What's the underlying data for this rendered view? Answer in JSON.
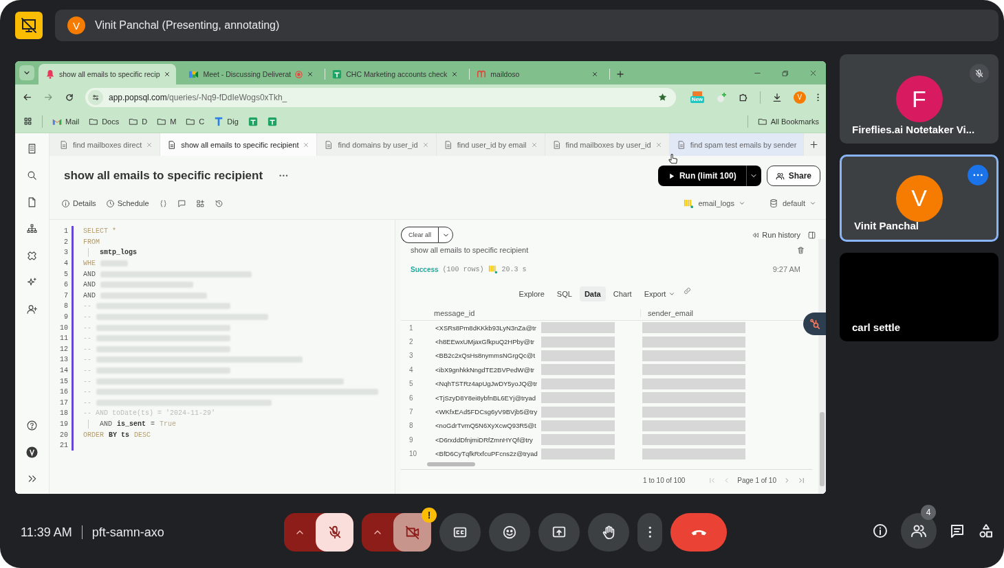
{
  "meeting": {
    "presenter_initial": "V",
    "presenter_banner": "Vinit Panchal (Presenting, annotating)"
  },
  "browser": {
    "tabs": [
      {
        "title": "show all emails to specific recip",
        "kind": "popsql",
        "selected": true,
        "recording": false
      },
      {
        "title": "Meet - Discussing Deliverat",
        "kind": "meet",
        "selected": false,
        "recording": true
      },
      {
        "title": "CHC Marketing accounts check",
        "kind": "sheets",
        "selected": false,
        "recording": false
      },
      {
        "title": "maildoso",
        "kind": "maildoso",
        "selected": false,
        "recording": false
      }
    ],
    "address": {
      "host": "app.popsql.com",
      "path": "/queries/-Nq9-fDdIeWogs0xTkh_"
    },
    "extension_badge": "New",
    "profile_initial": "V",
    "bookmarks": [
      {
        "label": "Mail",
        "kind": "gmail"
      },
      {
        "label": "Docs",
        "kind": "folder"
      },
      {
        "label": "D",
        "kind": "folder"
      },
      {
        "label": "M",
        "kind": "folder"
      },
      {
        "label": "C",
        "kind": "folder"
      },
      {
        "label": "Dig",
        "kind": "tool"
      },
      {
        "kind": "sheets"
      },
      {
        "kind": "sheets"
      }
    ],
    "all_bookmarks": "All Bookmarks"
  },
  "popsql": {
    "query_tabs": [
      {
        "title": "find mailboxes direct",
        "selected": false,
        "hovered": false
      },
      {
        "title": "show all emails to specific recipient",
        "selected": true,
        "hovered": false
      },
      {
        "title": "find domains by user_id",
        "selected": false,
        "hovered": false
      },
      {
        "title": "find user_id by email",
        "selected": false,
        "hovered": false
      },
      {
        "title": "find mailboxes by user_id",
        "selected": false,
        "hovered": false
      },
      {
        "title": "find spam test emails by sender",
        "selected": false,
        "hovered": true
      }
    ],
    "query_title": "show all emails to specific recipient",
    "toolbar": [
      {
        "label": "Details",
        "kind": "info"
      },
      {
        "label": "Schedule",
        "kind": "clock"
      },
      {
        "kind": "braces"
      },
      {
        "kind": "comment"
      },
      {
        "kind": "gridplus"
      },
      {
        "kind": "history"
      }
    ],
    "run_label": "Run (limit 100)",
    "share_label": "Share",
    "connection": "email_logs",
    "schema": "default",
    "code_lines": [
      {
        "number": "1",
        "indented": false,
        "parts": [
          {
            "kind": "keyword",
            "text": "SELECT *"
          }
        ]
      },
      {
        "number": "2",
        "indented": false,
        "parts": [
          {
            "kind": "keyword",
            "text": "FROM"
          }
        ]
      },
      {
        "number": "3",
        "indented": true,
        "parts": [
          {
            "kind": "ident",
            "text": "smtp_logs"
          }
        ]
      },
      {
        "number": "4",
        "indented": false,
        "parts": [
          {
            "kind": "keyword",
            "text": "WHE"
          },
          {
            "kind": "redacted"
          }
        ]
      },
      {
        "number": "5",
        "indented": false,
        "parts": [
          {
            "kind": "plain",
            "text": "AND"
          },
          {
            "kind": "redacted"
          }
        ]
      },
      {
        "number": "6",
        "indented": false,
        "parts": [
          {
            "kind": "plain",
            "text": "AND"
          },
          {
            "kind": "redacted"
          }
        ]
      },
      {
        "number": "7",
        "indented": false,
        "parts": [
          {
            "kind": "plain",
            "text": "AND"
          },
          {
            "kind": "redacted"
          }
        ]
      },
      {
        "number": "8",
        "indented": false,
        "parts": [
          {
            "kind": "comment",
            "text": "--"
          },
          {
            "kind": "redacted"
          }
        ]
      },
      {
        "number": "9",
        "indented": false,
        "parts": [
          {
            "kind": "comment",
            "text": "--"
          },
          {
            "kind": "redacted"
          }
        ]
      },
      {
        "number": "10",
        "indented": false,
        "parts": [
          {
            "kind": "comment",
            "text": "--"
          },
          {
            "kind": "redacted"
          }
        ]
      },
      {
        "number": "11",
        "indented": false,
        "parts": [
          {
            "kind": "comment",
            "text": "--"
          },
          {
            "kind": "redacted"
          }
        ]
      },
      {
        "number": "12",
        "indented": false,
        "parts": [
          {
            "kind": "comment",
            "text": "--"
          },
          {
            "kind": "redacted"
          }
        ]
      },
      {
        "number": "13",
        "indented": false,
        "parts": [
          {
            "kind": "comment",
            "text": "--"
          },
          {
            "kind": "redacted"
          }
        ]
      },
      {
        "number": "14",
        "indented": false,
        "parts": [
          {
            "kind": "comment",
            "text": "--"
          },
          {
            "kind": "redacted"
          }
        ]
      },
      {
        "number": "15",
        "indented": false,
        "parts": [
          {
            "kind": "comment",
            "text": "--"
          },
          {
            "kind": "redacted"
          }
        ]
      },
      {
        "number": "16",
        "indented": false,
        "parts": [
          {
            "kind": "comment",
            "text": "--"
          },
          {
            "kind": "redacted"
          }
        ]
      },
      {
        "number": "17",
        "indented": false,
        "parts": [
          {
            "kind": "comment",
            "text": "--"
          },
          {
            "kind": "redacted"
          }
        ]
      },
      {
        "number": "18",
        "indented": false,
        "parts": [
          {
            "kind": "comment",
            "text": "-- AND toDate(ts) = '2024-11-29'"
          }
        ]
      },
      {
        "number": "19",
        "indented": true,
        "parts": [
          {
            "kind": "plain",
            "text": "AND"
          },
          {
            "kind": "ident",
            "text": "is_sent"
          },
          {
            "kind": "plain",
            "text": "="
          },
          {
            "kind": "value",
            "text": "True"
          }
        ]
      },
      {
        "number": "20",
        "indented": false,
        "parts": [
          {
            "kind": "keyword",
            "text": "ORDER"
          },
          {
            "kind": "ident",
            "text": "BY ts"
          },
          {
            "kind": "keyword",
            "text": "DESC"
          }
        ]
      },
      {
        "number": "21",
        "indented": false
      }
    ],
    "results": {
      "clear_all": "Clear all",
      "run_history": "Run history",
      "title": "show all emails to specific recipient",
      "status": "Success",
      "row_count": "(100 rows)",
      "duration": "20.3 s",
      "time": "9:27 AM",
      "tabs": [
        {
          "label": "Explore",
          "selected": false,
          "menu": false
        },
        {
          "label": "SQL",
          "selected": false,
          "menu": false
        },
        {
          "label": "Data",
          "selected": true,
          "menu": false
        },
        {
          "label": "Chart",
          "selected": false,
          "menu": false
        },
        {
          "label": "Export",
          "selected": false,
          "menu": true
        }
      ],
      "columns": [
        "message_id",
        "sender_email"
      ],
      "rows": [
        {
          "number": "1",
          "message_id": "<XSRs8Pm8dKKkb93LyN3nZa@tr",
          "redacted": true
        },
        {
          "number": "2",
          "message_id": "<h8EEwxUMjaxGfkpuQ2HPby@tr",
          "redacted": true
        },
        {
          "number": "3",
          "message_id": "<BB2c2xQsHs8nymmsNGrgQc@t",
          "redacted": true
        },
        {
          "number": "4",
          "message_id": "<ibX9gnhkkNngdTE2BVPedW@tr",
          "redacted": true
        },
        {
          "number": "5",
          "message_id": "<NqhTSTRz4apUgJwDY5yoJQ@tr",
          "redacted": true
        },
        {
          "number": "6",
          "message_id": "<TjSzyD8Y8ei8ybfnBL6EYj@tryad",
          "redacted": true
        },
        {
          "number": "7",
          "message_id": "<WKfxEAd5FDCsg6yV9BVjb5@try",
          "redacted": true
        },
        {
          "number": "8",
          "message_id": "<noGdrTvmQ5N6XyXcwQ93R5@t",
          "redacted": true
        },
        {
          "number": "9",
          "message_id": "<D6rxddDfnjmiDRfZmnHYQf@try",
          "redacted": true
        },
        {
          "number": "10",
          "message_id": "<BfD6CyTqfkRxfcuPFcns2z@tryad",
          "redacted": true
        }
      ],
      "range": "1 to 10 of 100",
      "page": "Page 1 of 10"
    }
  },
  "participants": [
    {
      "name": "Fireflies.ai Notetaker Vi...",
      "initial": "F",
      "color": "#d81b60",
      "muted": true,
      "highlighted": false
    },
    {
      "name": "Vinit Panchal",
      "initial": "V",
      "color": "#f57c00",
      "muted": false,
      "highlighted": true
    },
    {
      "name": "carl settle",
      "muted": false,
      "highlighted": false
    }
  ],
  "call": {
    "time": "11:39 AM",
    "meeting_code": "pft-samn-axo",
    "mic_on": false,
    "camera_on": false,
    "camera_warning": "!",
    "people_count": "4",
    "controls": [
      {
        "kind": "captions"
      },
      {
        "kind": "emoji"
      },
      {
        "kind": "present"
      },
      {
        "kind": "hand"
      },
      {
        "kind": "more"
      }
    ]
  }
}
